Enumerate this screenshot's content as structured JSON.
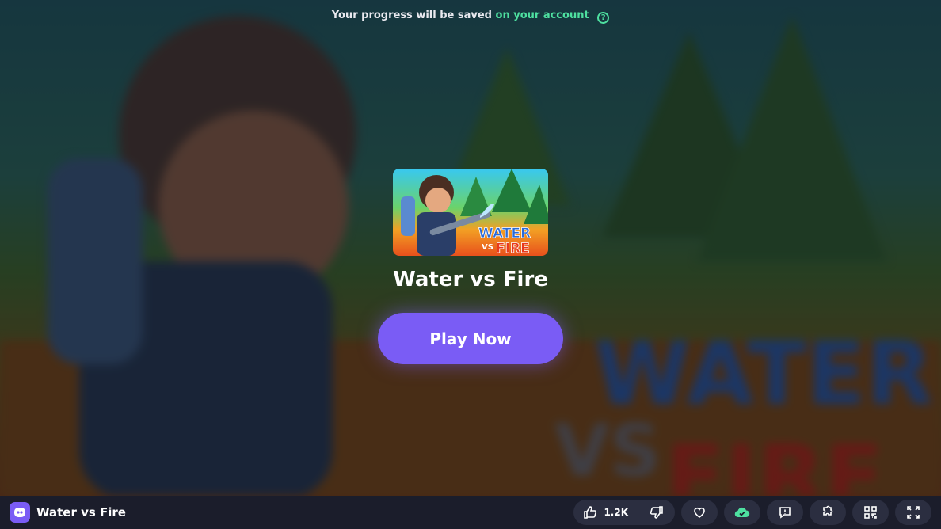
{
  "notice": {
    "text_before": "Your progress will be saved",
    "text_link": "on your account",
    "help_icon": "question-circle-icon"
  },
  "game": {
    "title": "Water vs Fire",
    "thumbnail_text_water": "WATER",
    "thumbnail_text_vs": "VS",
    "thumbnail_text_fire": "FIRE",
    "play_label": "Play Now"
  },
  "bottom_bar": {
    "title": "Water vs Fire",
    "like_count": "1.2K",
    "icons": [
      "thumbs-up-icon",
      "thumbs-down-icon",
      "heart-icon",
      "cloud-check-icon",
      "report-icon",
      "puzzle-icon",
      "qr-code-icon",
      "fullscreen-icon"
    ]
  },
  "colors": {
    "accent": "#7a5cf5",
    "link": "#4ee0a0",
    "bar": "#1b1d2b",
    "button_bg": "#2b2e40"
  }
}
